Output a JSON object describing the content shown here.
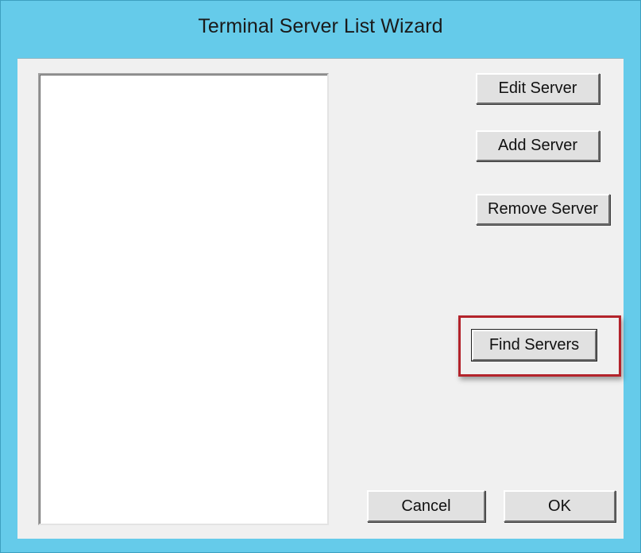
{
  "window": {
    "title": "Terminal Server List Wizard"
  },
  "server_list": {
    "items": []
  },
  "buttons": {
    "edit_server": "Edit Server",
    "add_server": "Add Server",
    "remove_server": "Remove Server",
    "find_servers": "Find Servers",
    "cancel": "Cancel",
    "ok": "OK"
  },
  "colors": {
    "titlebar": "#65cbea",
    "dialog_background": "#f0f0f0",
    "highlight_box": "#b3232b"
  }
}
